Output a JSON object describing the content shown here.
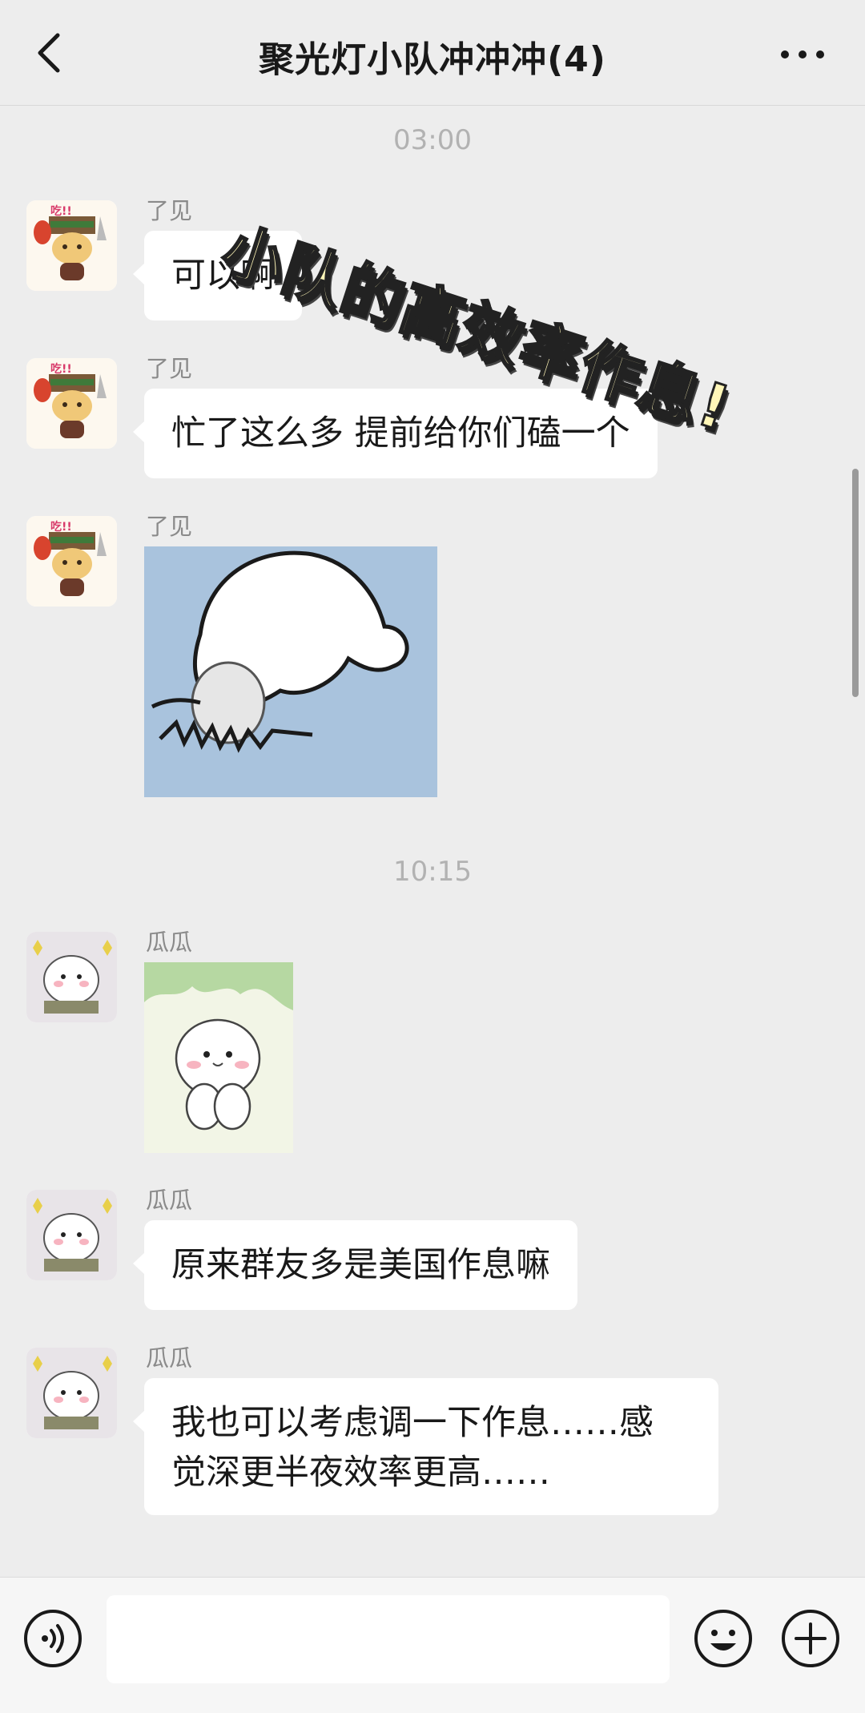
{
  "header": {
    "title": "聚光灯小队冲冲冲(4)"
  },
  "overlay_text": "小队的高效率作息!",
  "timestamps": [
    "03:00",
    "10:15"
  ],
  "messages": [
    {
      "sender": "了见",
      "text": "可以啊"
    },
    {
      "sender": "了见",
      "text": "忙了这么多 提前给你们磕一个"
    },
    {
      "sender": "了见",
      "image": "kowtow-cartoon-sticker"
    },
    {
      "sender": "瓜瓜",
      "image": "white-hamster-sticker"
    },
    {
      "sender": "瓜瓜",
      "text": "原来群友多是美国作息嘛"
    },
    {
      "sender": "瓜瓜",
      "text_line1": "我也可以考虑调一下作息……感",
      "text_line2": "觉深更半夜效率更高……"
    }
  ],
  "colors": {
    "background": "#ededed",
    "bubble": "#ffffff",
    "text": "#191919",
    "meta": "#8a8a8a"
  }
}
